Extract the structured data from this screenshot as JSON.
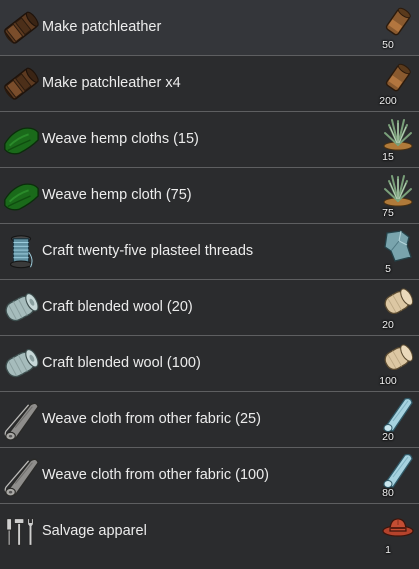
{
  "bills": [
    {
      "label": "Make patchleather",
      "product_icon": "patchleather-icon",
      "ingredient_icon": "leather-icon",
      "count": "50"
    },
    {
      "label": "Make patchleather x4",
      "product_icon": "patchleather-icon",
      "ingredient_icon": "leather-icon",
      "count": "200"
    },
    {
      "label": "Weave hemp cloths (15)",
      "product_icon": "hemp-cloth-icon",
      "ingredient_icon": "hemp-plant-icon",
      "count": "15"
    },
    {
      "label": "Weave hemp cloth (75)",
      "product_icon": "hemp-cloth-icon",
      "ingredient_icon": "hemp-plant-icon",
      "count": "75"
    },
    {
      "label": "Craft twenty-five plasteel threads",
      "product_icon": "thread-spool-icon",
      "ingredient_icon": "plasteel-icon",
      "count": "5"
    },
    {
      "label": "Craft blended wool (20)",
      "product_icon": "wool-bolt-icon",
      "ingredient_icon": "wool-icon",
      "count": "20"
    },
    {
      "label": "Craft blended wool (100)",
      "product_icon": "wool-bolt-icon",
      "ingredient_icon": "wool-icon",
      "count": "100"
    },
    {
      "label": "Weave cloth from other fabric (25)",
      "product_icon": "cloth-roll-icon",
      "ingredient_icon": "fabric-icon",
      "count": "20"
    },
    {
      "label": "Weave cloth from other fabric (100)",
      "product_icon": "cloth-roll-icon",
      "ingredient_icon": "fabric-icon",
      "count": "80"
    },
    {
      "label": "Salvage apparel",
      "product_icon": "tools-icon",
      "ingredient_icon": "cowboy-hat-icon",
      "count": "1"
    }
  ],
  "colors": {
    "background": "#2b2c2e",
    "divider": "#5e5f61",
    "text": "#ececec",
    "leather": "#6a4527",
    "hemp_cloth": "#1d6b1d",
    "wool": "#a9bfbf",
    "cloth": "#8a8a88",
    "plasteel": "#7aa4ad",
    "fabric": "#a8d3e0",
    "wool_ingredient": "#e0ccaa",
    "hat": "#b8452e"
  }
}
